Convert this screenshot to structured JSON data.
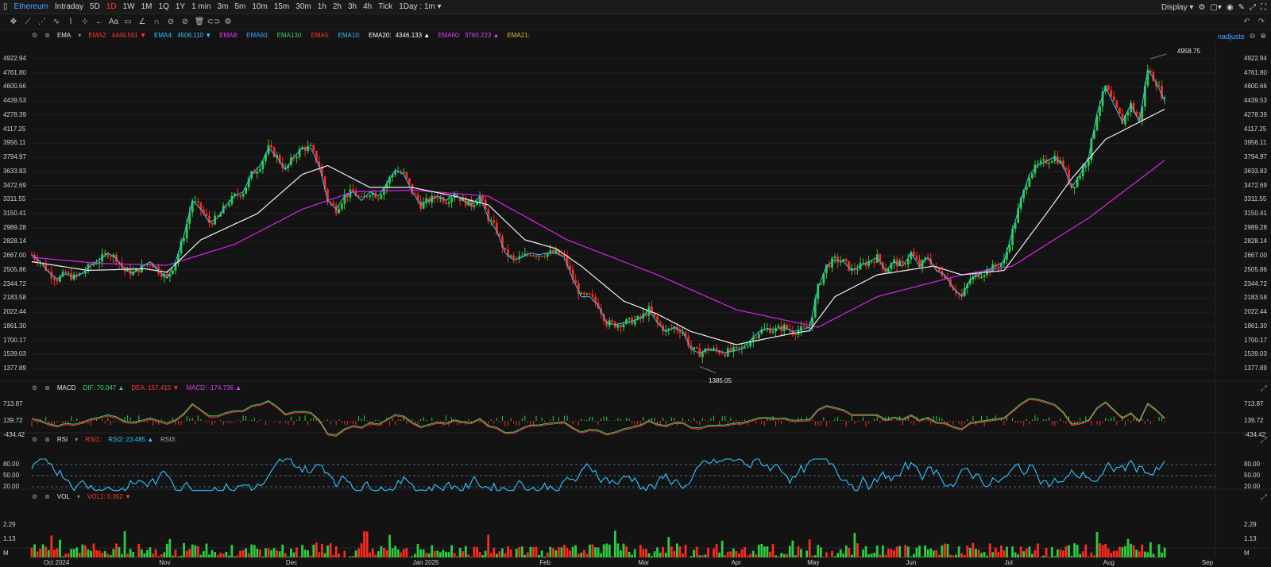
{
  "symbol": "Ethereum",
  "periods": [
    "Intraday",
    "5D",
    "1D",
    "1W",
    "1M",
    "1Q",
    "1Y",
    "1 min",
    "3m",
    "5m",
    "10m",
    "15m",
    "30m",
    "1h",
    "2h",
    "3h",
    "4h",
    "Tick"
  ],
  "active_period": "1D",
  "interval_select": "1Day : 1m",
  "display_label": "Display",
  "user": "nadjuste",
  "toolbar_icons": [
    "crosshair-icon",
    "line-tool-icon",
    "channel-tool-icon",
    "wave-tool-icon",
    "brush-icon",
    "measure-icon",
    "undo-icon",
    "text-icon",
    "comment-icon",
    "pen-icon",
    "magnet-icon",
    "lock-icon",
    "eye-off-icon",
    "trash-icon",
    "link-icon",
    "settings-icon"
  ],
  "ema_legend": {
    "name": "EMA",
    "items": [
      {
        "label": "EMA2:",
        "value": "4449.591",
        "color": "#ff3b30",
        "arrow": "▼"
      },
      {
        "label": "EMA4:",
        "value": "4506.110",
        "color": "#2ec5ff",
        "arrow": "▼"
      },
      {
        "label": "EMA8:",
        "value": "",
        "color": "#e040fb",
        "arrow": ""
      },
      {
        "label": "EMA60:",
        "value": "",
        "color": "#4aa3ff",
        "arrow": ""
      },
      {
        "label": "EMA130:",
        "value": "",
        "color": "#36d36e",
        "arrow": ""
      },
      {
        "label": "EMA5:",
        "value": "",
        "color": "#ff3b30",
        "arrow": ""
      },
      {
        "label": "EMA10:",
        "value": "",
        "color": "#2ec5ff",
        "arrow": ""
      },
      {
        "label": "EMA20:",
        "value": "4346.133",
        "color": "#ffffff",
        "arrow": "▲"
      },
      {
        "label": "EMA60:",
        "value": "3760.223",
        "color": "#e040fb",
        "arrow": "▲"
      },
      {
        "label": "EMA21:",
        "value": "",
        "color": "#d4c030",
        "arrow": ""
      }
    ]
  },
  "macd_legend": {
    "name": "MACD",
    "dif": "DIF:",
    "dif_value": "70.047",
    "dea": "DEA:",
    "dea_value": "157.415",
    "macd": "MACD:",
    "macd_value": "-174.736"
  },
  "rsi_legend": {
    "name": "RSI",
    "rsi1": "RSI1:",
    "rsi2": "RSI2:",
    "rsi2_value": "23.485",
    "rsi3": "RSI3:"
  },
  "vol_legend": {
    "name": "VOL",
    "vol1": "VOL1:",
    "vol1_value": "0.352"
  },
  "price_axis": [
    "4922.94",
    "4761.80",
    "4600.66",
    "4439.53",
    "4278.39",
    "4117.25",
    "3956.11",
    "3794.97",
    "3633.83",
    "3472.69",
    "3311.55",
    "3150.41",
    "2989.28",
    "2828.14",
    "2667.00",
    "2505.86",
    "2344.72",
    "2183.58",
    "2022.44",
    "1861.30",
    "1700.17",
    "1539.03",
    "1377.89"
  ],
  "macd_axis": [
    "713.87",
    "139.72",
    "-434.42"
  ],
  "rsi_axis": [
    "80.00",
    "50.00",
    "20.00"
  ],
  "vol_axis": [
    "2.29",
    "1.13",
    "M"
  ],
  "x_axis": [
    "Oct 2024",
    "Nov",
    "Dec",
    "Jan 2025",
    "Feb",
    "Mar",
    "Apr",
    "May",
    "Jun",
    "Jul",
    "Aug",
    "Sep"
  ],
  "high_marker": "4958.75",
  "low_marker": "1385.05",
  "chart_data": {
    "type": "line",
    "title": "",
    "price_range": [
      1377.89,
      4922.94
    ],
    "close_path": [
      [
        0,
        2680
      ],
      [
        3,
        2600
      ],
      [
        6,
        2480
      ],
      [
        9,
        2400
      ],
      [
        12,
        2460
      ],
      [
        15,
        2420
      ],
      [
        18,
        2470
      ],
      [
        21,
        2560
      ],
      [
        24,
        2620
      ],
      [
        27,
        2700
      ],
      [
        30,
        2640
      ],
      [
        33,
        2500
      ],
      [
        36,
        2470
      ],
      [
        39,
        2540
      ],
      [
        42,
        2600
      ],
      [
        45,
        2500
      ],
      [
        48,
        2410
      ],
      [
        51,
        2600
      ],
      [
        54,
        2900
      ],
      [
        57,
        3300
      ],
      [
        60,
        3200
      ],
      [
        63,
        3050
      ],
      [
        66,
        3100
      ],
      [
        69,
        3250
      ],
      [
        72,
        3350
      ],
      [
        75,
        3400
      ],
      [
        78,
        3600
      ],
      [
        81,
        3700
      ],
      [
        84,
        3900
      ],
      [
        87,
        3800
      ],
      [
        90,
        3650
      ],
      [
        93,
        3800
      ],
      [
        96,
        3900
      ],
      [
        99,
        3900
      ],
      [
        102,
        3700
      ],
      [
        105,
        3300
      ],
      [
        108,
        3200
      ],
      [
        111,
        3350
      ],
      [
        114,
        3400
      ],
      [
        117,
        3300
      ],
      [
        120,
        3400
      ],
      [
        123,
        3350
      ],
      [
        126,
        3500
      ],
      [
        129,
        3650
      ],
      [
        132,
        3600
      ],
      [
        135,
        3400
      ],
      [
        138,
        3250
      ],
      [
        141,
        3300
      ],
      [
        144,
        3350
      ],
      [
        147,
        3300
      ],
      [
        150,
        3380
      ],
      [
        153,
        3300
      ],
      [
        156,
        3250
      ],
      [
        159,
        3350
      ],
      [
        162,
        3100
      ],
      [
        165,
        2950
      ],
      [
        168,
        2700
      ],
      [
        171,
        2620
      ],
      [
        174,
        2650
      ],
      [
        177,
        2700
      ],
      [
        180,
        2680
      ],
      [
        183,
        2700
      ],
      [
        186,
        2700
      ],
      [
        189,
        2650
      ],
      [
        192,
        2400
      ],
      [
        195,
        2200
      ],
      [
        198,
        2200
      ],
      [
        201,
        2100
      ],
      [
        204,
        1900
      ],
      [
        207,
        1880
      ],
      [
        210,
        1900
      ],
      [
        213,
        1920
      ],
      [
        216,
        1950
      ],
      [
        219,
        2050
      ],
      [
        222,
        1900
      ],
      [
        225,
        1800
      ],
      [
        228,
        1850
      ],
      [
        231,
        1800
      ],
      [
        234,
        1600
      ],
      [
        237,
        1550
      ],
      [
        240,
        1600
      ],
      [
        243,
        1580
      ],
      [
        246,
        1560
      ],
      [
        249,
        1580
      ],
      [
        252,
        1600
      ],
      [
        255,
        1700
      ],
      [
        258,
        1800
      ],
      [
        261,
        1830
      ],
      [
        264,
        1820
      ],
      [
        267,
        1850
      ],
      [
        270,
        1800
      ],
      [
        273,
        1820
      ],
      [
        276,
        1850
      ],
      [
        279,
        2300
      ],
      [
        282,
        2550
      ],
      [
        285,
        2620
      ],
      [
        288,
        2600
      ],
      [
        291,
        2500
      ],
      [
        294,
        2550
      ],
      [
        297,
        2600
      ],
      [
        300,
        2650
      ],
      [
        303,
        2500
      ],
      [
        306,
        2600
      ],
      [
        309,
        2550
      ],
      [
        312,
        2700
      ],
      [
        315,
        2550
      ],
      [
        318,
        2650
      ],
      [
        321,
        2500
      ],
      [
        324,
        2450
      ],
      [
        327,
        2300
      ],
      [
        330,
        2200
      ],
      [
        333,
        2400
      ],
      [
        336,
        2450
      ],
      [
        339,
        2500
      ],
      [
        342,
        2550
      ],
      [
        345,
        2600
      ],
      [
        348,
        2950
      ],
      [
        351,
        3300
      ],
      [
        354,
        3600
      ],
      [
        357,
        3700
      ],
      [
        360,
        3750
      ],
      [
        363,
        3800
      ],
      [
        366,
        3700
      ],
      [
        369,
        3450
      ],
      [
        372,
        3600
      ],
      [
        375,
        3800
      ],
      [
        378,
        4300
      ],
      [
        381,
        4600
      ],
      [
        384,
        4400
      ],
      [
        387,
        4200
      ],
      [
        390,
        4400
      ],
      [
        393,
        4200
      ],
      [
        396,
        4800
      ],
      [
        399,
        4650
      ],
      [
        402,
        4440
      ]
    ],
    "ema20_path": [
      [
        0,
        2600
      ],
      [
        20,
        2500
      ],
      [
        40,
        2520
      ],
      [
        48,
        2480
      ],
      [
        60,
        2850
      ],
      [
        80,
        3150
      ],
      [
        96,
        3600
      ],
      [
        105,
        3700
      ],
      [
        120,
        3450
      ],
      [
        135,
        3450
      ],
      [
        150,
        3350
      ],
      [
        162,
        3250
      ],
      [
        175,
        2850
      ],
      [
        186,
        2750
      ],
      [
        195,
        2550
      ],
      [
        210,
        2150
      ],
      [
        222,
        2000
      ],
      [
        234,
        1800
      ],
      [
        250,
        1650
      ],
      [
        270,
        1780
      ],
      [
        276,
        1810
      ],
      [
        285,
        2200
      ],
      [
        300,
        2450
      ],
      [
        320,
        2550
      ],
      [
        330,
        2450
      ],
      [
        345,
        2500
      ],
      [
        360,
        3150
      ],
      [
        369,
        3550
      ],
      [
        381,
        4000
      ],
      [
        402,
        4346
      ]
    ],
    "ema60_path": [
      [
        0,
        2650
      ],
      [
        24,
        2580
      ],
      [
        48,
        2560
      ],
      [
        72,
        2800
      ],
      [
        96,
        3200
      ],
      [
        114,
        3400
      ],
      [
        135,
        3420
      ],
      [
        162,
        3350
      ],
      [
        190,
        2850
      ],
      [
        222,
        2450
      ],
      [
        250,
        2050
      ],
      [
        279,
        1850
      ],
      [
        300,
        2200
      ],
      [
        330,
        2450
      ],
      [
        348,
        2550
      ],
      [
        375,
        3100
      ],
      [
        402,
        3760
      ]
    ],
    "x_index_range": [
      0,
      420
    ],
    "months": [
      {
        "label": "Oct 2024",
        "idx": 7
      },
      {
        "label": "Nov",
        "idx": 48
      },
      {
        "label": "Dec",
        "idx": 93
      },
      {
        "label": "Jan 2025",
        "idx": 138
      },
      {
        "label": "Feb",
        "idx": 183
      },
      {
        "label": "Mar",
        "idx": 218
      },
      {
        "label": "Apr",
        "idx": 251
      },
      {
        "label": "May",
        "idx": 278
      },
      {
        "label": "Jun",
        "idx": 313
      },
      {
        "label": "Jul",
        "idx": 348
      },
      {
        "label": "Aug",
        "idx": 383
      },
      {
        "label": "Sep",
        "idx": 418
      }
    ]
  }
}
